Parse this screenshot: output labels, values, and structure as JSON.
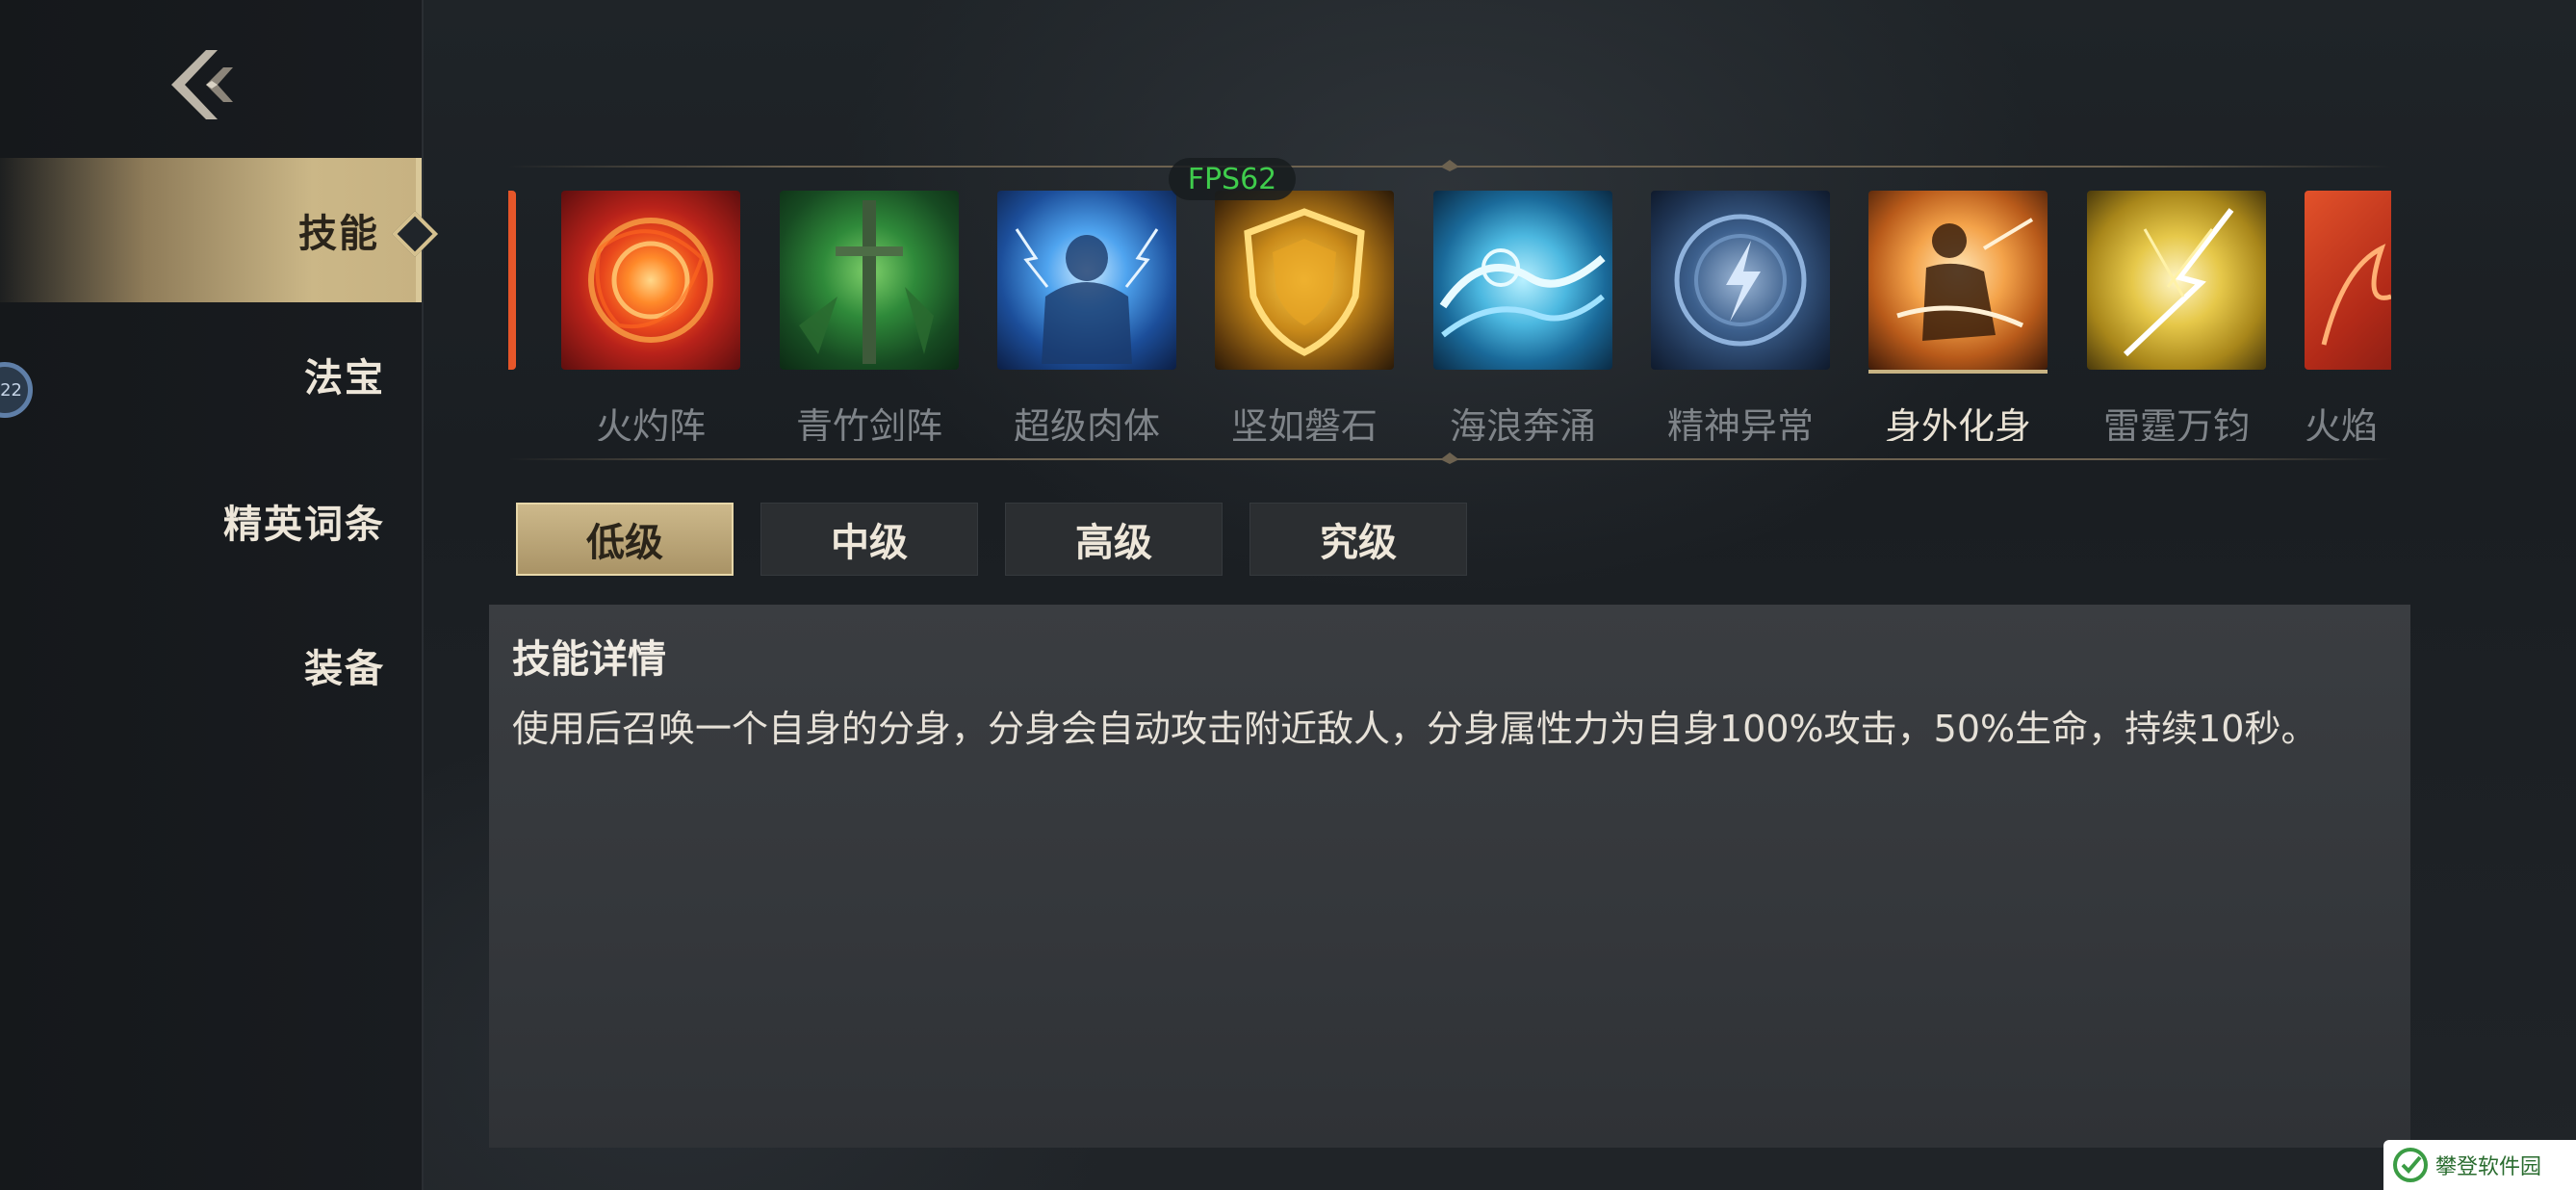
{
  "app": {
    "fps_label": "FPS62",
    "watermark": "攀登软件园"
  },
  "sidebar": {
    "back_icon": "back-chevron-icon",
    "badge_text": "22",
    "items": [
      {
        "label": "技能",
        "active": true
      },
      {
        "label": "法宝",
        "active": false
      },
      {
        "label": "精英词条",
        "active": false
      },
      {
        "label": "装备",
        "active": false
      }
    ]
  },
  "skills": {
    "selected": "身外化身",
    "items": [
      {
        "label": "火灼阵",
        "icon": "fire-vortex-icon"
      },
      {
        "label": "青竹剑阵",
        "icon": "bamboo-sword-icon"
      },
      {
        "label": "超级肉体",
        "icon": "lightning-giant-icon"
      },
      {
        "label": "坚如磐石",
        "icon": "golden-shield-icon"
      },
      {
        "label": "海浪奔涌",
        "icon": "ocean-wave-icon"
      },
      {
        "label": "精神异常",
        "icon": "mind-lightning-icon"
      },
      {
        "label": "身外化身",
        "icon": "clone-warrior-icon"
      },
      {
        "label": "雷霆万钧",
        "icon": "golden-thunder-icon"
      },
      {
        "label": "火焰",
        "icon": "flame-icon"
      }
    ]
  },
  "levels": {
    "tabs": [
      "低级",
      "中级",
      "高级",
      "究级"
    ],
    "active": "低级"
  },
  "detail": {
    "title": "技能详情",
    "description": "使用后召唤一个自身的分身，分身会自动攻击附近敌人，分身属性力为自身100%攻击，50%生命，持续10秒。"
  },
  "colors": {
    "accent_gold": "#c8b383",
    "fps_green": "#3fcc4c",
    "panel_bg": "#3a3d41"
  }
}
